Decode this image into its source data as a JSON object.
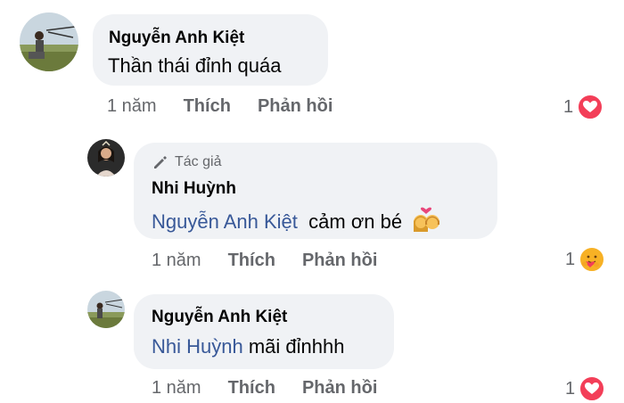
{
  "comments": [
    {
      "author": "Nguyễn Anh Kiệt",
      "text": "Thần thái đỉnh quáa",
      "time": "1 năm",
      "like_label": "Thích",
      "reply_label": "Phản hồi",
      "reaction_count": "1",
      "reaction_icon": "heart-icon"
    },
    {
      "badge": "Tác giả",
      "author": "Nhi Huỳnh",
      "mention": "Nguyễn Anh Kiệt",
      "text": "cảm ơn bé",
      "emoji": "couple-with-heart-emoji",
      "time": "1 năm",
      "like_label": "Thích",
      "reply_label": "Phản hồi",
      "reaction_count": "1",
      "reaction_icon": "care-hug-icon"
    },
    {
      "author": "Nguyễn Anh Kiệt",
      "mention": "Nhi Huỳnh",
      "text": "mãi đỉnhhh",
      "time": "1 năm",
      "like_label": "Thích",
      "reply_label": "Phản hồi",
      "reaction_count": "1",
      "reaction_icon": "heart-icon"
    }
  ],
  "colors": {
    "bubble": "#f0f2f5",
    "mention": "#385898",
    "meta": "#65676b",
    "heart": "#f33e58",
    "care": "#f7b125"
  }
}
